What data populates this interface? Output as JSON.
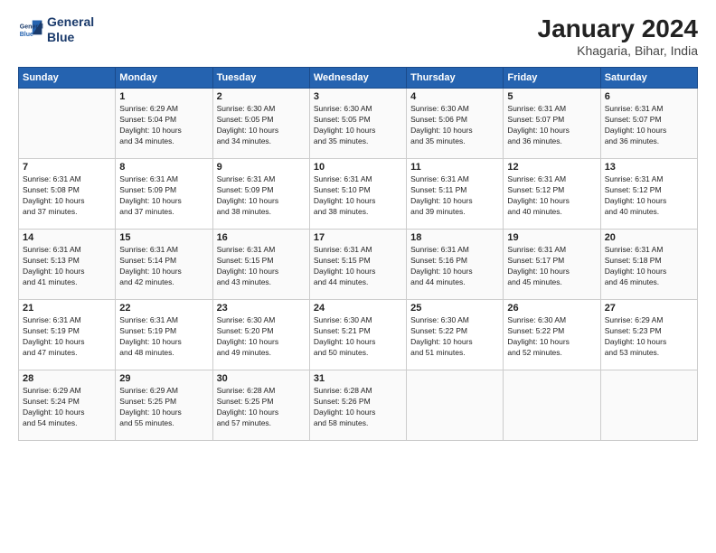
{
  "logo": {
    "line1": "General",
    "line2": "Blue"
  },
  "title": "January 2024",
  "subtitle": "Khagaria, Bihar, India",
  "headers": [
    "Sunday",
    "Monday",
    "Tuesday",
    "Wednesday",
    "Thursday",
    "Friday",
    "Saturday"
  ],
  "weeks": [
    [
      {
        "num": "",
        "sunrise": "",
        "sunset": "",
        "daylight": ""
      },
      {
        "num": "1",
        "sunrise": "Sunrise: 6:29 AM",
        "sunset": "Sunset: 5:04 PM",
        "daylight": "Daylight: 10 hours and 34 minutes."
      },
      {
        "num": "2",
        "sunrise": "Sunrise: 6:30 AM",
        "sunset": "Sunset: 5:05 PM",
        "daylight": "Daylight: 10 hours and 34 minutes."
      },
      {
        "num": "3",
        "sunrise": "Sunrise: 6:30 AM",
        "sunset": "Sunset: 5:05 PM",
        "daylight": "Daylight: 10 hours and 35 minutes."
      },
      {
        "num": "4",
        "sunrise": "Sunrise: 6:30 AM",
        "sunset": "Sunset: 5:06 PM",
        "daylight": "Daylight: 10 hours and 35 minutes."
      },
      {
        "num": "5",
        "sunrise": "Sunrise: 6:31 AM",
        "sunset": "Sunset: 5:07 PM",
        "daylight": "Daylight: 10 hours and 36 minutes."
      },
      {
        "num": "6",
        "sunrise": "Sunrise: 6:31 AM",
        "sunset": "Sunset: 5:07 PM",
        "daylight": "Daylight: 10 hours and 36 minutes."
      }
    ],
    [
      {
        "num": "7",
        "sunrise": "Sunrise: 6:31 AM",
        "sunset": "Sunset: 5:08 PM",
        "daylight": "Daylight: 10 hours and 37 minutes."
      },
      {
        "num": "8",
        "sunrise": "Sunrise: 6:31 AM",
        "sunset": "Sunset: 5:09 PM",
        "daylight": "Daylight: 10 hours and 37 minutes."
      },
      {
        "num": "9",
        "sunrise": "Sunrise: 6:31 AM",
        "sunset": "Sunset: 5:09 PM",
        "daylight": "Daylight: 10 hours and 38 minutes."
      },
      {
        "num": "10",
        "sunrise": "Sunrise: 6:31 AM",
        "sunset": "Sunset: 5:10 PM",
        "daylight": "Daylight: 10 hours and 38 minutes."
      },
      {
        "num": "11",
        "sunrise": "Sunrise: 6:31 AM",
        "sunset": "Sunset: 5:11 PM",
        "daylight": "Daylight: 10 hours and 39 minutes."
      },
      {
        "num": "12",
        "sunrise": "Sunrise: 6:31 AM",
        "sunset": "Sunset: 5:12 PM",
        "daylight": "Daylight: 10 hours and 40 minutes."
      },
      {
        "num": "13",
        "sunrise": "Sunrise: 6:31 AM",
        "sunset": "Sunset: 5:12 PM",
        "daylight": "Daylight: 10 hours and 40 minutes."
      }
    ],
    [
      {
        "num": "14",
        "sunrise": "Sunrise: 6:31 AM",
        "sunset": "Sunset: 5:13 PM",
        "daylight": "Daylight: 10 hours and 41 minutes."
      },
      {
        "num": "15",
        "sunrise": "Sunrise: 6:31 AM",
        "sunset": "Sunset: 5:14 PM",
        "daylight": "Daylight: 10 hours and 42 minutes."
      },
      {
        "num": "16",
        "sunrise": "Sunrise: 6:31 AM",
        "sunset": "Sunset: 5:15 PM",
        "daylight": "Daylight: 10 hours and 43 minutes."
      },
      {
        "num": "17",
        "sunrise": "Sunrise: 6:31 AM",
        "sunset": "Sunset: 5:15 PM",
        "daylight": "Daylight: 10 hours and 44 minutes."
      },
      {
        "num": "18",
        "sunrise": "Sunrise: 6:31 AM",
        "sunset": "Sunset: 5:16 PM",
        "daylight": "Daylight: 10 hours and 44 minutes."
      },
      {
        "num": "19",
        "sunrise": "Sunrise: 6:31 AM",
        "sunset": "Sunset: 5:17 PM",
        "daylight": "Daylight: 10 hours and 45 minutes."
      },
      {
        "num": "20",
        "sunrise": "Sunrise: 6:31 AM",
        "sunset": "Sunset: 5:18 PM",
        "daylight": "Daylight: 10 hours and 46 minutes."
      }
    ],
    [
      {
        "num": "21",
        "sunrise": "Sunrise: 6:31 AM",
        "sunset": "Sunset: 5:19 PM",
        "daylight": "Daylight: 10 hours and 47 minutes."
      },
      {
        "num": "22",
        "sunrise": "Sunrise: 6:31 AM",
        "sunset": "Sunset: 5:19 PM",
        "daylight": "Daylight: 10 hours and 48 minutes."
      },
      {
        "num": "23",
        "sunrise": "Sunrise: 6:30 AM",
        "sunset": "Sunset: 5:20 PM",
        "daylight": "Daylight: 10 hours and 49 minutes."
      },
      {
        "num": "24",
        "sunrise": "Sunrise: 6:30 AM",
        "sunset": "Sunset: 5:21 PM",
        "daylight": "Daylight: 10 hours and 50 minutes."
      },
      {
        "num": "25",
        "sunrise": "Sunrise: 6:30 AM",
        "sunset": "Sunset: 5:22 PM",
        "daylight": "Daylight: 10 hours and 51 minutes."
      },
      {
        "num": "26",
        "sunrise": "Sunrise: 6:30 AM",
        "sunset": "Sunset: 5:22 PM",
        "daylight": "Daylight: 10 hours and 52 minutes."
      },
      {
        "num": "27",
        "sunrise": "Sunrise: 6:29 AM",
        "sunset": "Sunset: 5:23 PM",
        "daylight": "Daylight: 10 hours and 53 minutes."
      }
    ],
    [
      {
        "num": "28",
        "sunrise": "Sunrise: 6:29 AM",
        "sunset": "Sunset: 5:24 PM",
        "daylight": "Daylight: 10 hours and 54 minutes."
      },
      {
        "num": "29",
        "sunrise": "Sunrise: 6:29 AM",
        "sunset": "Sunset: 5:25 PM",
        "daylight": "Daylight: 10 hours and 55 minutes."
      },
      {
        "num": "30",
        "sunrise": "Sunrise: 6:28 AM",
        "sunset": "Sunset: 5:25 PM",
        "daylight": "Daylight: 10 hours and 57 minutes."
      },
      {
        "num": "31",
        "sunrise": "Sunrise: 6:28 AM",
        "sunset": "Sunset: 5:26 PM",
        "daylight": "Daylight: 10 hours and 58 minutes."
      },
      {
        "num": "",
        "sunrise": "",
        "sunset": "",
        "daylight": ""
      },
      {
        "num": "",
        "sunrise": "",
        "sunset": "",
        "daylight": ""
      },
      {
        "num": "",
        "sunrise": "",
        "sunset": "",
        "daylight": ""
      }
    ]
  ]
}
